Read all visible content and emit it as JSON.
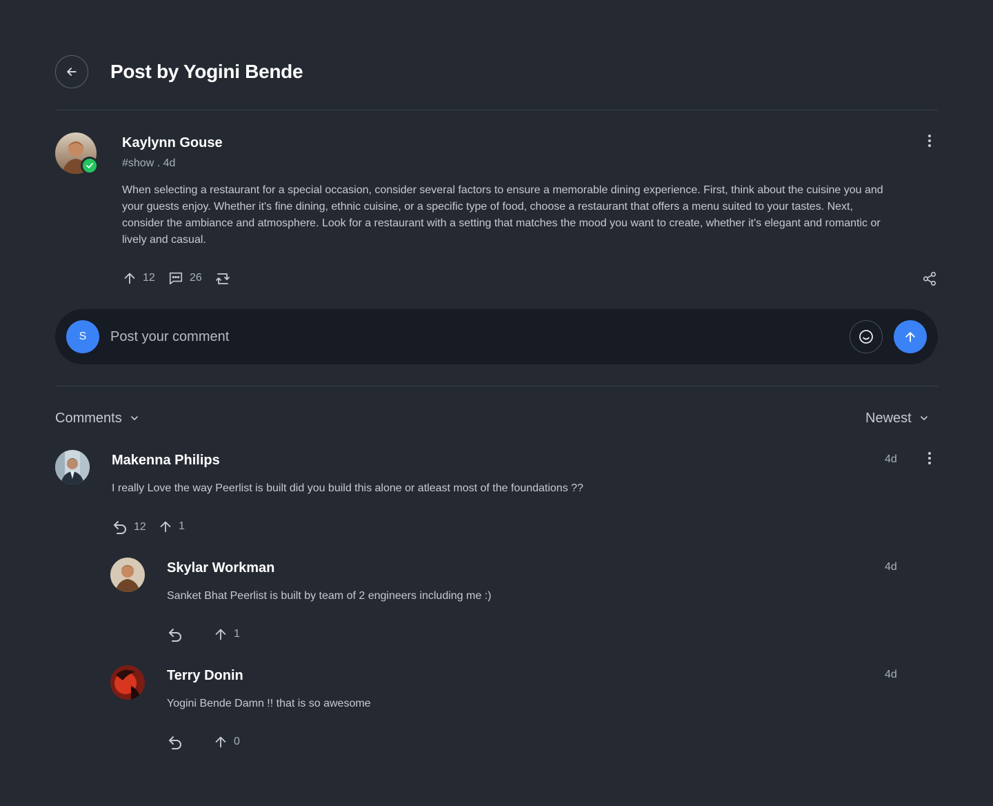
{
  "header": {
    "title": "Post by Yogini Bende"
  },
  "post": {
    "author": "Kaylynn Gouse",
    "meta": "#show . 4d",
    "body": "When selecting a restaurant for a special occasion, consider several factors to ensure a memorable dining experience. First, think about the cuisine you and your guests enjoy. Whether it's fine dining, ethnic cuisine, or a specific type of food, choose a restaurant that offers a menu suited to your tastes. Next, consider the ambiance and atmosphere. Look for a restaurant with a setting that matches the mood you want to create, whether it's elegant and romantic or lively and casual.",
    "upvotes": "12",
    "comments": "26"
  },
  "composer": {
    "avatar_initial": "S",
    "placeholder": "Post your comment"
  },
  "comments_section": {
    "filter_label": "Comments",
    "sort_label": "Newest",
    "items": [
      {
        "name": "Makenna Philips",
        "time": "4d",
        "text": "I really Love the way Peerlist is built did you build this alone or atleast most of the foundations ??",
        "replies": "12",
        "upvotes": "1"
      }
    ],
    "replies": [
      {
        "name": "Skylar Workman",
        "time": "4d",
        "text": "Sanket Bhat Peerlist is built by team of 2 engineers including me :)",
        "upvotes": "1"
      },
      {
        "name": "Terry Donin",
        "time": "4d",
        "text": "Yogini Bende Damn !! that is so awesome",
        "upvotes": "0"
      }
    ]
  },
  "colors": {
    "background": "#252a32",
    "composer_bg": "#161b24",
    "accent": "#3b82f6",
    "verified": "#22c55e"
  }
}
